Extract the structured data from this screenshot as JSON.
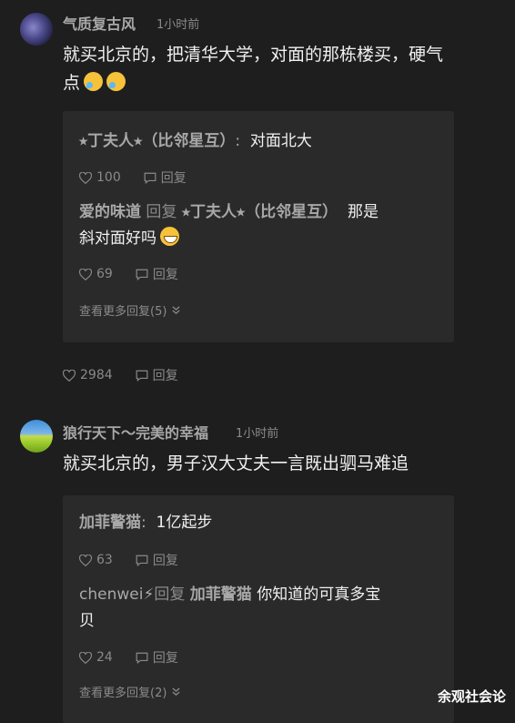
{
  "comments": [
    {
      "username": "气质复古风",
      "time": "1小时前",
      "text_line1": "就买北京的，把清华大学，对面的那栋楼买，硬气",
      "text_line2": "点",
      "emojis": [
        "crying-laughing-emoji",
        "crying-laughing-emoji"
      ],
      "replies": [
        {
          "name": "⭑丁夫人⭑（比邻星互）",
          "sep": ":",
          "text": "对面北大",
          "likes": "100",
          "reply_label": "回复"
        },
        {
          "name": "爱的味道",
          "reply_word": "回复",
          "target": "⭑丁夫人⭑（比邻星互）",
          "text_a": "那是",
          "text_b": "斜对面好吗",
          "emoji": "grinning-emoji",
          "likes": "69",
          "reply_label": "回复"
        }
      ],
      "more_replies": "查看更多回复(5)",
      "likes": "2984",
      "reply_label": "回复"
    },
    {
      "username": "狼行天下～完美的幸福",
      "time": "1小时前",
      "text": "就买北京的，男子汉大丈夫一言既出驷马难追",
      "replies": [
        {
          "name": "加菲警猫",
          "sep": ":",
          "text": "1亿起步",
          "likes": "63",
          "reply_label": "回复"
        },
        {
          "name": "chenwei⚡",
          "reply_word": "回复",
          "target": "加菲警猫",
          "text_a": "你知道的可真多宝",
          "text_b": "贝",
          "likes": "24",
          "reply_label": "回复"
        }
      ],
      "more_replies": "查看更多回复(2)"
    }
  ],
  "watermark": "余观社会论"
}
